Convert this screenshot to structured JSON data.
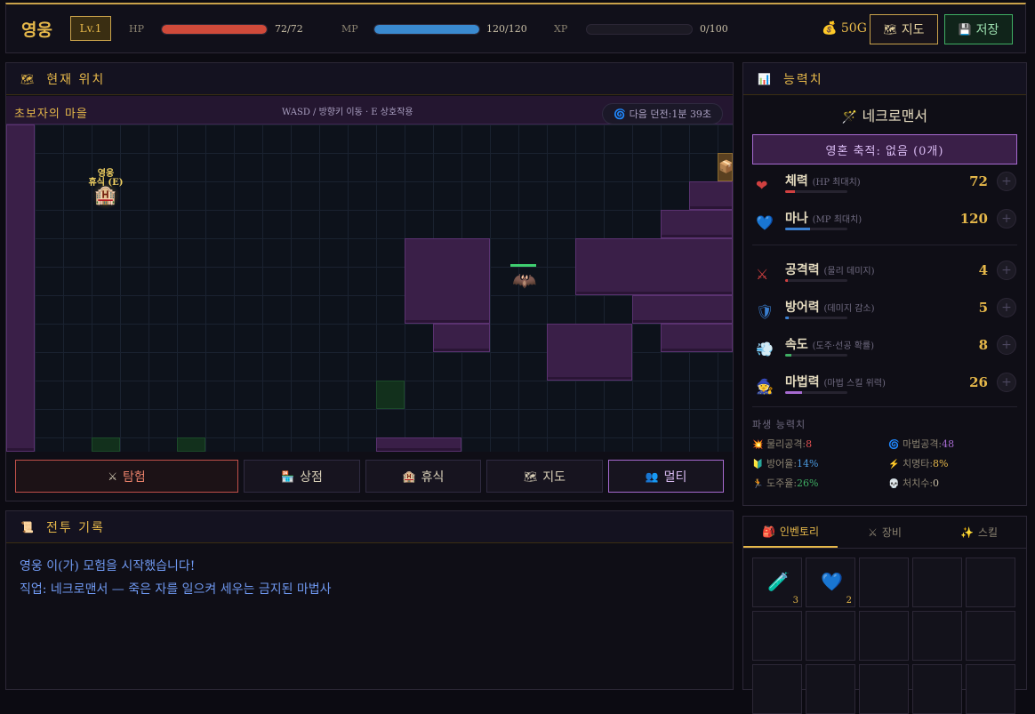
{
  "topbar": {
    "hero_name": "영웅",
    "level": "Lv.1",
    "hp_label": "HP",
    "hp_value": "72/72",
    "hp_fraction": 1.0,
    "mp_label": "MP",
    "mp_value": "120/120",
    "mp_fraction": 1.0,
    "xp_label": "XP",
    "xp_value": "0/100",
    "xp_fraction": 0.0,
    "gold": "50G",
    "map_button": "지도",
    "save_button": "저장"
  },
  "location_panel": {
    "title": "현재 위치",
    "town_name": "초보자의 마을",
    "controls_hint": "WASD / 방향키 이동 · E 상호작용",
    "next_dungeon": "다음 던전:1분 39초",
    "npc_label_line1": "영웅",
    "npc_label_line2": "휴식 (E)"
  },
  "actions": {
    "explore": "탐험",
    "shop": "상점",
    "rest": "휴식",
    "map": "지도",
    "multi": "멀티"
  },
  "battle_log": {
    "title": "전투 기록",
    "lines": [
      "영웅 이(가) 모험을 시작했습니다!",
      "직업: 네크로맨서 — 죽은 자를 일으켜 세우는 금지된 마법사"
    ]
  },
  "stats_panel": {
    "title": "능력치",
    "class_name": "네크로맨서",
    "soul_stack": "영혼 축적: 없음 (0개)",
    "stats": [
      {
        "name": "체력",
        "sub": "(HP 최대치)",
        "value": "72",
        "level": 0.15,
        "color": "#d04040",
        "icon": "heart-icon"
      },
      {
        "name": "마나",
        "sub": "(MP 최대치)",
        "value": "120",
        "level": 0.4,
        "color": "#3a7fd0",
        "icon": "blue-heart-icon"
      },
      {
        "name": "공격력",
        "sub": "(물리 데미지)",
        "value": "4",
        "level": 0.04,
        "color": "#d04040",
        "icon": "crossed-swords-icon"
      },
      {
        "name": "방어력",
        "sub": "(데미지 감소)",
        "value": "5",
        "level": 0.05,
        "color": "#3a7fd0",
        "icon": "shield-icon"
      },
      {
        "name": "속도",
        "sub": "(도주·선공 확률)",
        "value": "8",
        "level": 0.1,
        "color": "#3fae63",
        "icon": "wind-icon"
      },
      {
        "name": "마법력",
        "sub": "(마법 스킬 위력)",
        "value": "26",
        "level": 0.27,
        "color": "#a66ad0",
        "icon": "wizard-icon"
      }
    ],
    "derived_title": "파생 능력치",
    "derived": [
      {
        "label": "물리공격:",
        "value": "8",
        "color": "#e05050"
      },
      {
        "label": "마법공격:",
        "value": "48",
        "color": "#a66ad0"
      },
      {
        "label": "방어율:",
        "value": "14%",
        "color": "#4a9ae0"
      },
      {
        "label": "치명타:",
        "value": "8%",
        "color": "#e6b84a"
      },
      {
        "label": "도주율:",
        "value": "26%",
        "color": "#3fae63"
      },
      {
        "label": "처치수:",
        "value": "0",
        "color": "#c9bfa6"
      }
    ]
  },
  "inventory": {
    "tabs": [
      "인벤토리",
      "장비",
      "스킬"
    ],
    "active_tab": "인벤토리",
    "items": [
      {
        "icon": "potion-icon",
        "qty": "3"
      },
      {
        "icon": "blue-heart-icon",
        "qty": "2"
      }
    ]
  }
}
